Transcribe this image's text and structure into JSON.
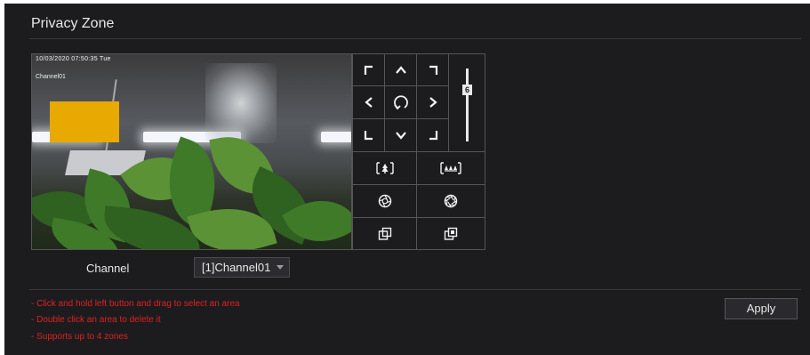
{
  "page": {
    "title": "Privacy Zone"
  },
  "video": {
    "osd_datetime": "10/03/2020 07:50:35 Tue",
    "osd_channel": "Channel01",
    "privacy_mask_color": "#e8a900"
  },
  "ptz": {
    "zoom_level": "6",
    "icons": {
      "up_left": "arrow-up-left-icon",
      "up": "arrow-up-icon",
      "up_right": "arrow-up-right-icon",
      "left": "arrow-left-icon",
      "auto": "rotate-auto-icon",
      "right": "arrow-right-icon",
      "down_left": "arrow-down-left-icon",
      "down": "arrow-down-icon",
      "down_right": "arrow-down-right-icon",
      "zoom_in": "zoom-in-icon",
      "zoom_out": "zoom-out-icon",
      "iris_open": "iris-open-icon",
      "iris_close": "iris-close-icon",
      "focus_near": "focus-near-icon",
      "focus_far": "focus-far-icon"
    }
  },
  "form": {
    "channel_label": "Channel",
    "channel_value": "[1]Channel01"
  },
  "hints": [
    "- Click and hold left button and drag to select an area",
    "- Double click an area to delete it",
    "- Supports up to 4 zones"
  ],
  "actions": {
    "apply_label": "Apply"
  },
  "colors": {
    "background": "#1c1c1f",
    "hint": "#e02020",
    "text": "#e8e8e8"
  }
}
